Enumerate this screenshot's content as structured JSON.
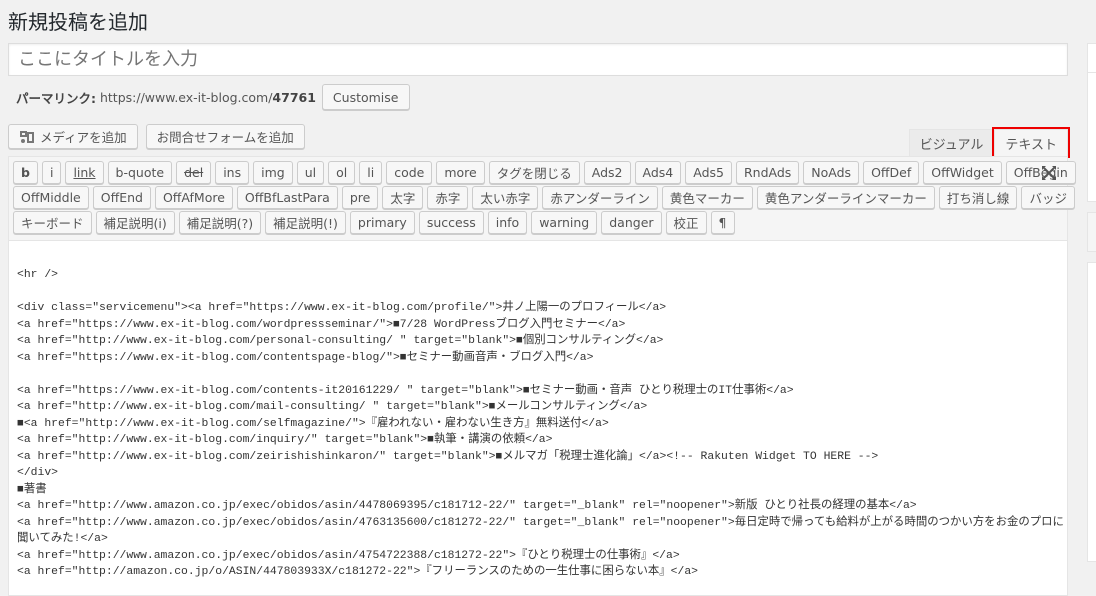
{
  "page_title": "新規投稿を追加",
  "title_placeholder": "ここにタイトルを入力",
  "permalink": {
    "label": "パーマリンク:",
    "url_prefix": "https://www.ex-it-blog.com/",
    "post_id": "47761",
    "customise": "Customise"
  },
  "media_buttons": [
    "メディアを追加",
    "お問合せフォームを追加"
  ],
  "tabs": {
    "visual": "ビジュアル",
    "text": "テキスト",
    "active": "text",
    "highlight_color": "#e00000"
  },
  "toolbar": {
    "row1": [
      "b",
      "i",
      "link",
      "b-quote",
      "del",
      "ins",
      "img",
      "ul",
      "ol",
      "li",
      "code",
      "more",
      "タグを閉じる",
      "Ads2",
      "Ads4",
      "Ads5",
      "RndAds",
      "NoAds",
      "OffDef",
      "OffWidget",
      "OffBegin"
    ],
    "row2": [
      "OffMiddle",
      "OffEnd",
      "OffAfMore",
      "OffBfLastPara",
      "pre",
      "太字",
      "赤字",
      "太い赤字",
      "赤アンダーライン",
      "黄色マーカー",
      "黄色アンダーラインマーカー",
      "打ち消し線",
      "バッジ"
    ],
    "row3": [
      "キーボード",
      "補足説明(i)",
      "補足説明(?)",
      "補足説明(!)",
      "primary",
      "success",
      "info",
      "warning",
      "danger",
      "校正",
      "¶"
    ],
    "fullscreen_icon": "expand-icon"
  },
  "content_lines": [
    "<hr />",
    "",
    "<div class=\"servicemenu\"><a href=\"https://www.ex-it-blog.com/profile/\">井ノ上陽一のプロフィール</a>",
    "<a href=\"https://www.ex-it-blog.com/wordpressseminar/\">■7/28 WordPressブログ入門セミナー</a>",
    "<a href=\"http://www.ex-it-blog.com/personal-consulting/ \" target=\"blank\">■個別コンサルティング</a>",
    "<a href=\"https://www.ex-it-blog.com/contentspage-blog/\">■セミナー動画音声・ブログ入門</a>",
    "",
    "<a href=\"https://www.ex-it-blog.com/contents-it20161229/ \" target=\"blank\">■セミナー動画・音声 ひとり税理士のIT仕事術</a>",
    "<a href=\"http://www.ex-it-blog.com/mail-consulting/ \" target=\"blank\">■メールコンサルティング</a>",
    "■<a href=\"http://www.ex-it-blog.com/selfmagazine/\">『雇われない・雇わない生き方』無料送付</a>",
    "<a href=\"http://www.ex-it-blog.com/inquiry/\" target=\"blank\">■執筆・講演の依頼</a>",
    "<a href=\"http://www.ex-it-blog.com/zeirishishinkaron/\" target=\"blank\">■メルマガ「税理士進化論」</a><!-- Rakuten Widget TO HERE -->",
    "</div>",
    "■著書",
    "<a href=\"http://www.amazon.co.jp/exec/obidos/asin/4478069395/c181712-22/\" target=\"_blank\" rel=\"noopener\">新版 ひとり社長の経理の基本</a>",
    "<a href=\"http://www.amazon.co.jp/exec/obidos/asin/4763135600/c181272-22/\" target=\"_blank\" rel=\"noopener\">毎日定時で帰っても給料が上がる時間のつかい方をお金のプロに",
    "聞いてみた!</a>",
    "<a href=\"http://www.amazon.co.jp/exec/obidos/asin/4754722388/c181272-22\">『ひとり税理士の仕事術』</a>",
    "<a href=\"http://amazon.co.jp/o/ASIN/447803933X/c181272-22\">『フリーランスのための一生仕事に困らない本』</a>"
  ]
}
